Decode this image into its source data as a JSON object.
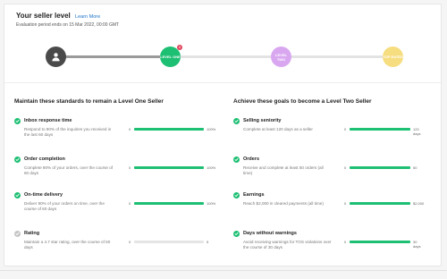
{
  "header": {
    "title": "Your seller level",
    "learn_more": "Learn More",
    "subtitle": "Evaluation period ends on 15 Mar 2022, 00:00 GMT"
  },
  "progress": {
    "nodes": [
      {
        "label": "",
        "icon": "user-icon",
        "color": "#4a4a4a"
      },
      {
        "label": "LEVEL ONE",
        "color": "#1dbf73",
        "badge": "1"
      },
      {
        "label": "LEVEL TWO",
        "color": "#d9a7f0"
      },
      {
        "label": "TOP RATED",
        "color": "#f6dd7f"
      }
    ]
  },
  "left": {
    "title": "Maintain these standards to remain a Level One Seller",
    "items": [
      {
        "name": "Inbox response time",
        "desc": "Respond to 90% of the inquiries you received in the last 60 days",
        "min": "0",
        "max": "100%",
        "progress": 1.0,
        "done": true
      },
      {
        "name": "Order completion",
        "desc": "Complete 90% of your orders, over the course of 60 days",
        "min": "0",
        "max": "100%",
        "progress": 1.0,
        "done": true
      },
      {
        "name": "On-time delivery",
        "desc": "Deliver 90% of your orders on time, over the course of 60 days",
        "min": "0",
        "max": "100%",
        "progress": 1.0,
        "done": true
      },
      {
        "name": "Rating",
        "desc": "Maintain a 4.7 star rating, over the course of 60 days",
        "min": "0",
        "max": "5",
        "progress": 0.0,
        "done": false
      }
    ]
  },
  "right": {
    "title": "Achieve these goals to become a Level Two Seller",
    "items": [
      {
        "name": "Selling seniority",
        "desc": "Complete at least 120 days as a seller",
        "min": "0",
        "max": "120 days",
        "progress": 1.0,
        "done": true
      },
      {
        "name": "Orders",
        "desc": "Receive and complete at least 50 orders (all time)",
        "min": "0",
        "max": "50",
        "progress": 1.0,
        "done": true
      },
      {
        "name": "Earnings",
        "desc": "Reach $2,000 in cleared payments (all time)",
        "min": "0",
        "max": "$2,000",
        "progress": 1.0,
        "done": true
      },
      {
        "name": "Days without warnings",
        "desc": "Avoid receiving warnings for TOS violations over the course of 30 days",
        "min": "0",
        "max": "30 days",
        "progress": 1.0,
        "done": true
      }
    ]
  }
}
